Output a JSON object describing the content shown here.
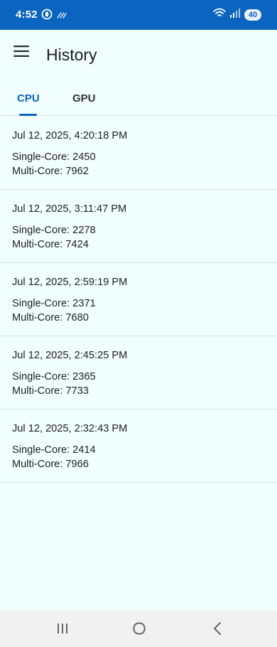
{
  "status_bar": {
    "time": "4:52",
    "battery": "40",
    "icons": [
      "notification-circle-icon",
      "signal-wave-icon",
      "wifi-icon",
      "cell-signal-icon"
    ]
  },
  "app_bar": {
    "title": "History",
    "menu_icon": "hamburger-menu-icon"
  },
  "tabs": [
    {
      "label": "CPU",
      "selected": true
    },
    {
      "label": "GPU",
      "selected": false
    }
  ],
  "history": [
    {
      "date": "Jul 12, 2025, 4:20:18 PM",
      "single": "Single-Core: 2450",
      "multi": "Multi-Core: 7962"
    },
    {
      "date": "Jul 12, 2025, 3:11:47 PM",
      "single": "Single-Core: 2278",
      "multi": "Multi-Core: 7424"
    },
    {
      "date": "Jul 12, 2025, 2:59:19 PM",
      "single": "Single-Core: 2371",
      "multi": "Multi-Core: 7680"
    },
    {
      "date": "Jul 12, 2025, 2:45:25 PM",
      "single": "Single-Core: 2365",
      "multi": "Multi-Core: 7733"
    },
    {
      "date": "Jul 12, 2025, 2:32:43 PM",
      "single": "Single-Core: 2414",
      "multi": "Multi-Core: 7966"
    }
  ],
  "nav_bar": {
    "icons": [
      "recents-icon",
      "home-icon",
      "back-icon"
    ]
  },
  "colors": {
    "accent": "#0b64bf",
    "background": "#f0fefe",
    "status_bar": "#0b64bf",
    "nav_bar": "#f1f1f1"
  }
}
